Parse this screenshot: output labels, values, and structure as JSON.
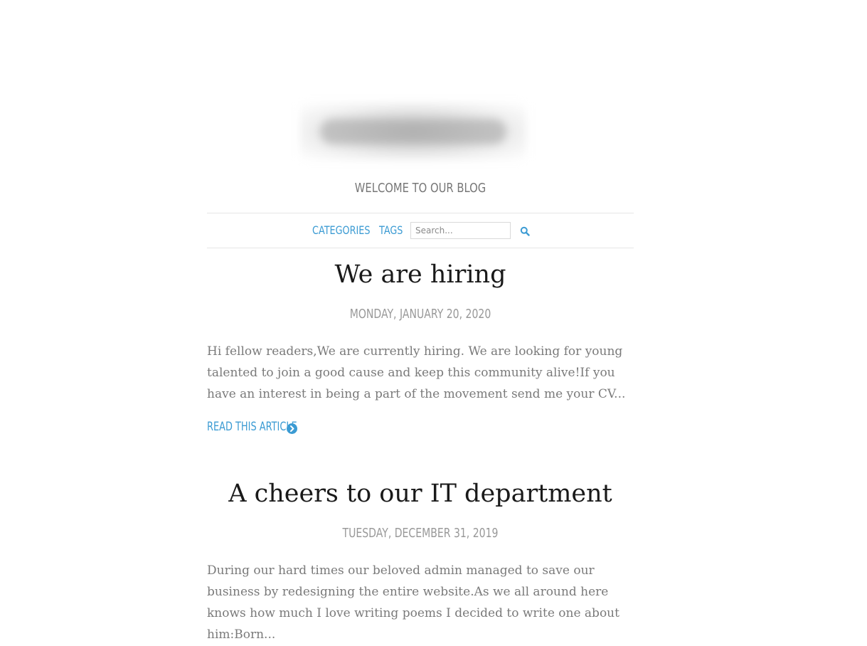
{
  "header": {
    "tagline": "WELCOME TO OUR BLOG"
  },
  "nav": {
    "categories_label": "CATEGORIES",
    "tags_label": "TAGS",
    "search_placeholder": "Search...",
    "search_icon": "search-icon"
  },
  "posts": [
    {
      "title": "We are hiring",
      "date": "MONDAY, JANUARY 20, 2020",
      "excerpt": "Hi fellow readers,We are currently hiring. We are looking for young talented to join a good cause and keep this community alive!If you have an interest in being a part of the movement send me your CV...",
      "read_more": "READ THIS ARTICLE"
    },
    {
      "title": "A cheers to our IT department",
      "date": "TUESDAY, DECEMBER 31, 2019",
      "excerpt": "During our hard times our beloved admin managed to save our business by redesigning the entire website.As we all around here knows how much I love writing poems I decided to write one about him:Born..."
    }
  ],
  "colors": {
    "accent": "#3b9bd3",
    "title": "#1a1a1a",
    "muted": "#999999",
    "body_text": "#7a7a7a",
    "rule": "#e6e6e6"
  }
}
